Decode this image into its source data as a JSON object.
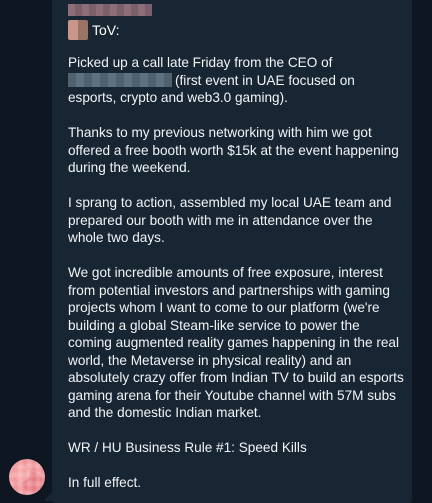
{
  "message": {
    "sender_name": "ToV:",
    "paragraphs": [
      {
        "before": "Picked up a call late Friday from the CEO of",
        "after": "(first event in UAE focused on esports, crypto and web3.0 gaming)."
      },
      {
        "text": "Thanks to my previous networking with him we got offered a free booth worth $15k at the event happening during the weekend."
      },
      {
        "text": "I sprang to action, assembled my local UAE team and prepared our booth with me in attendance over the whole two days."
      },
      {
        "text": "We got incredible amounts of free exposure, interest from potential investors and partnerships with gaming projects whom I want to come to our platform (we're building a global Steam-like service to power the coming augmented reality games happening in the real world, the Metaverse in physical reality) and an absolutely crazy offer from Indian TV to build an esports gaming arena for their Youtube channel with 57M subs and the domestic Indian market."
      },
      {
        "text": "WR / HU Business Rule #1: Speed Kills"
      },
      {
        "text": "In full effect."
      }
    ]
  },
  "colors": {
    "background": "#0e1621",
    "bubble": "#182533",
    "text": "#f2f4f6"
  }
}
